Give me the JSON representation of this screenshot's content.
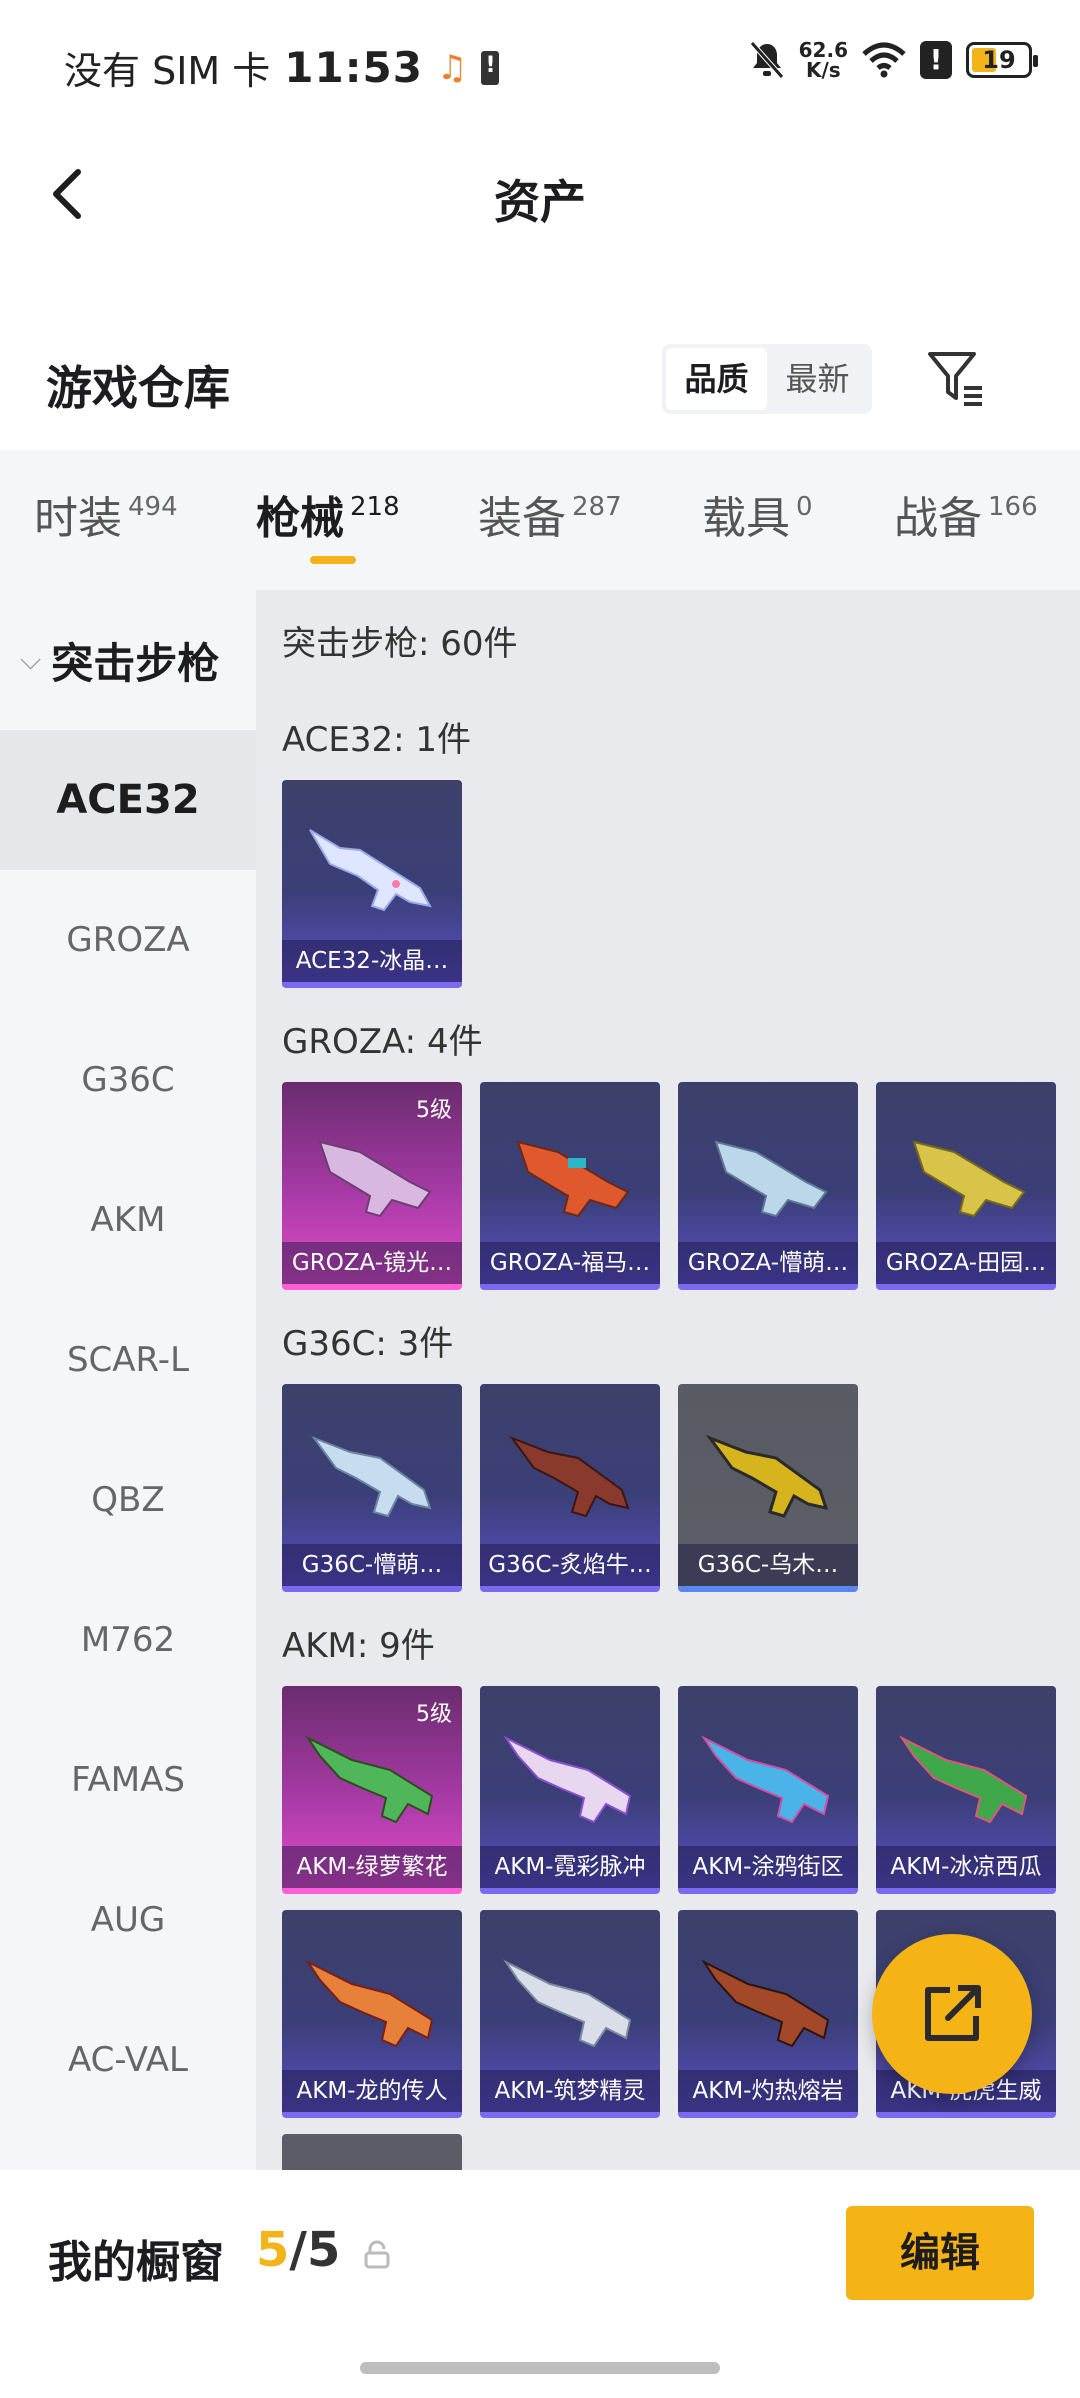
{
  "status_bar": {
    "carrier": "没有 SIM 卡",
    "time": "11:53",
    "net_speed_value": "62.6",
    "net_speed_unit": "K/s",
    "battery": "19"
  },
  "header": {
    "title": "资产"
  },
  "warehouse": {
    "title": "游戏仓库",
    "sort_options": [
      "品质",
      "最新"
    ]
  },
  "tabs": [
    {
      "label": "时装",
      "count": "494"
    },
    {
      "label": "枪械",
      "count": "218"
    },
    {
      "label": "装备",
      "count": "287"
    },
    {
      "label": "载具",
      "count": "0"
    },
    {
      "label": "战备",
      "count": "166"
    }
  ],
  "sidebar": {
    "category": "突击步枪",
    "items": [
      "ACE32",
      "GROZA",
      "G36C",
      "AKM",
      "SCAR-L",
      "QBZ",
      "M762",
      "FAMAS",
      "AUG",
      "AC-VAL"
    ]
  },
  "content": {
    "summary": "突击步枪: 60件",
    "sections": [
      {
        "title": "ACE32: 1件",
        "items": [
          {
            "name": "ACE32-冰晶…"
          }
        ]
      },
      {
        "title": "GROZA: 4件",
        "items": [
          {
            "name": "GROZA-镜光…",
            "level": "5级"
          },
          {
            "name": "GROZA-福马…"
          },
          {
            "name": "GROZA-懵萌…"
          },
          {
            "name": "GROZA-田园…"
          }
        ]
      },
      {
        "title": "G36C: 3件",
        "items": [
          {
            "name": "G36C-懵萌…"
          },
          {
            "name": "G36C-炙焰牛…"
          },
          {
            "name": "G36C-乌木…"
          }
        ]
      },
      {
        "title": "AKM: 9件",
        "items": [
          {
            "name": "AKM-绿萝繁花",
            "level": "5级"
          },
          {
            "name": "AKM-霓彩脉冲"
          },
          {
            "name": "AKM-涂鸦街区"
          },
          {
            "name": "AKM-冰凉西瓜"
          },
          {
            "name": "AKM-龙的传人"
          },
          {
            "name": "AKM-筑梦精灵"
          },
          {
            "name": "AKM-灼热熔岩"
          },
          {
            "name": "AKM-虎虎生威"
          }
        ]
      }
    ]
  },
  "bottom_bar": {
    "label": "我的橱窗",
    "current": "5",
    "total": "/5",
    "edit_label": "编辑"
  },
  "colors": {
    "accent": "#f5b315",
    "rarity_purple": "#7b6af0",
    "rarity_pink": "#e24cc6"
  }
}
